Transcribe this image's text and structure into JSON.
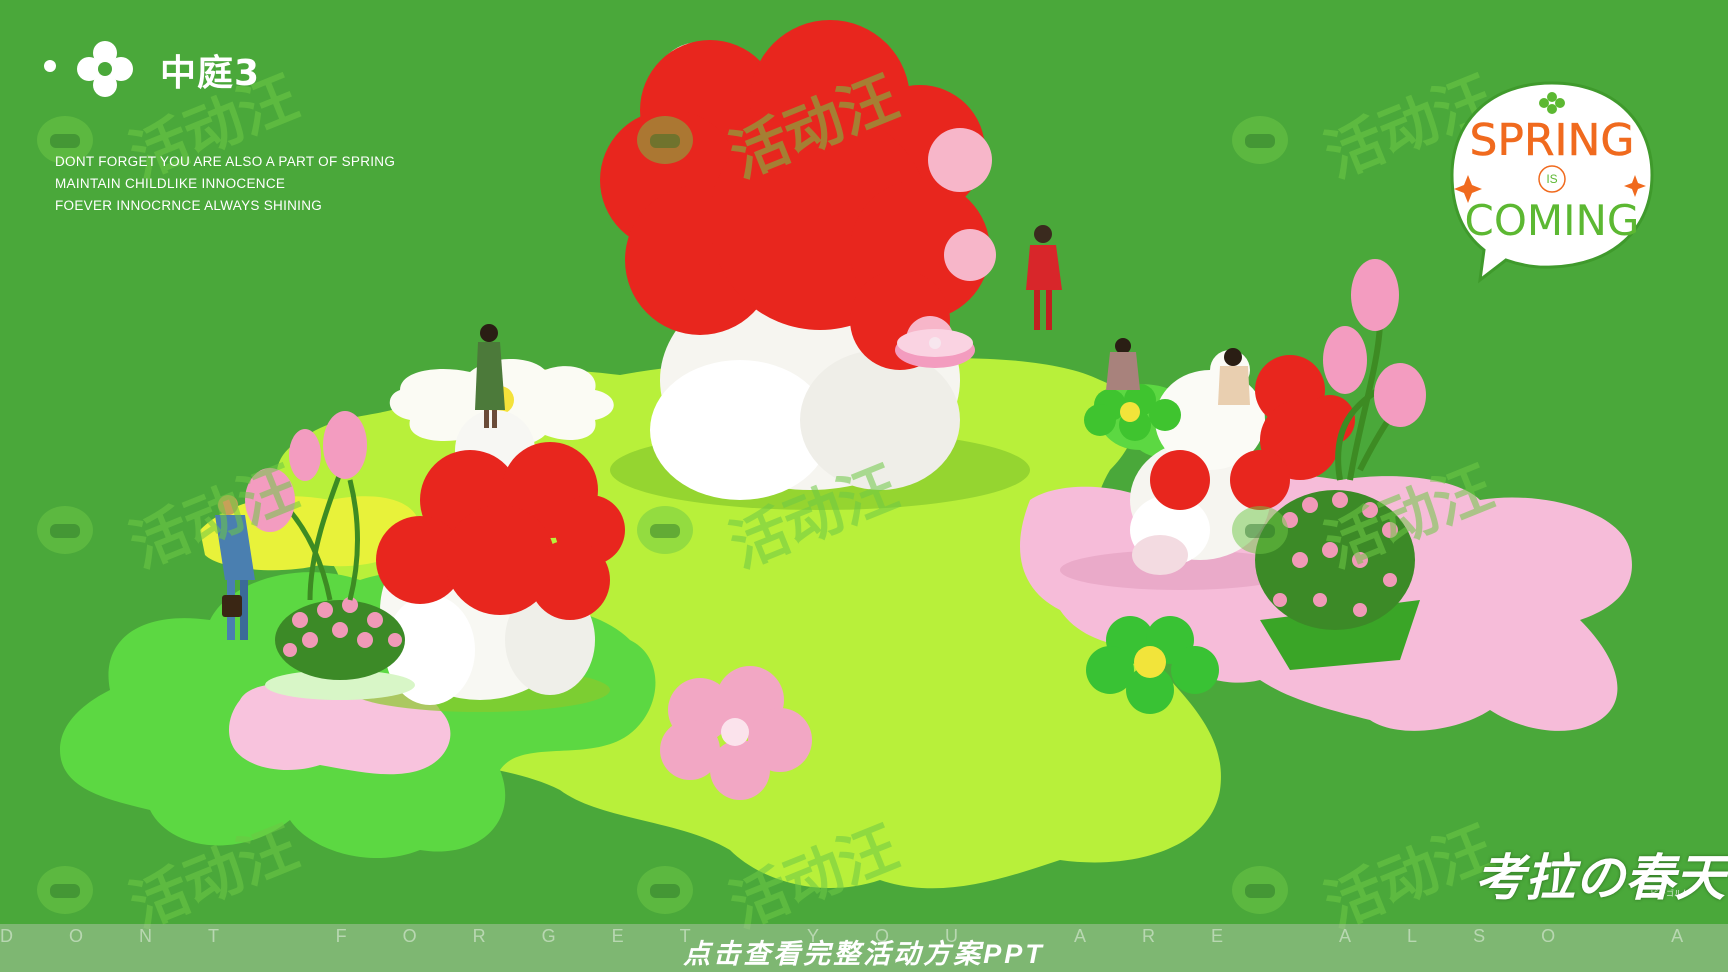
{
  "header": {
    "brand_name": "中庭3",
    "slogans": [
      "DONT FORGET YOU ARE ALSO A PART OF SPRING",
      "MAINTAIN CHILDLIKE INNOCENCE",
      "FOEVER INNOCRNCE ALWAYS SHINING"
    ]
  },
  "badge": {
    "line1": "SPRING",
    "line2": "IS",
    "line3": "COMING"
  },
  "watermark": {
    "text": "活动汪"
  },
  "koala_title": "考拉の春天",
  "koala_sub": "ピーゴルケ",
  "footer": {
    "background_text": "DONT FORGET YOU ARE ALSO A PART OF SPRING",
    "cta": "点击查看完整活动方案PPT"
  },
  "colors": {
    "background_green": "#4aa83a",
    "lime_floor": "#b8f03a",
    "bright_green_pad": "#5cd842",
    "pink_pad": "#f6bcd9",
    "red": "#e8261e",
    "white": "#fafaf6",
    "badge_text_orange": "#f06a1e",
    "badge_text_green": "#5cb832"
  }
}
